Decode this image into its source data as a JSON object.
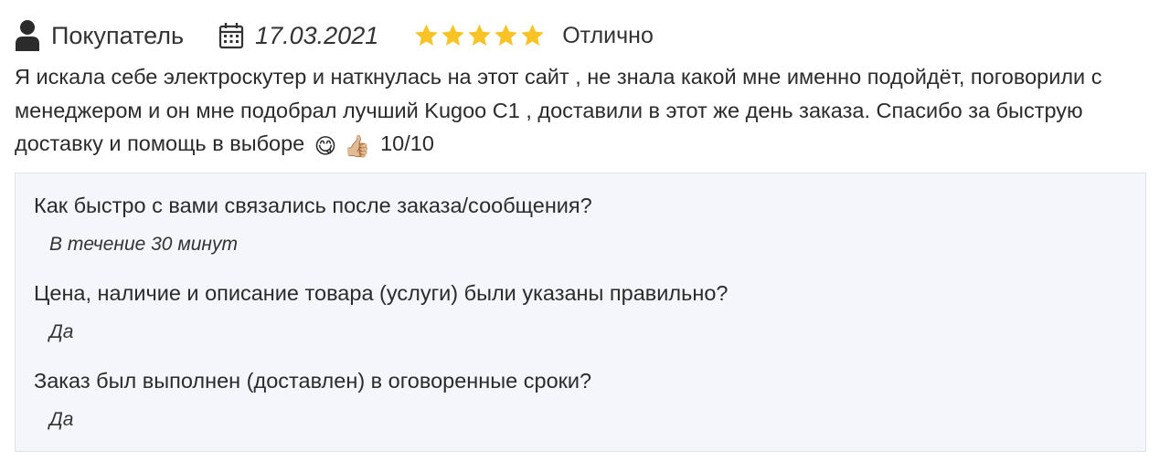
{
  "review": {
    "author": "Покупатель",
    "date": "17.03.2021",
    "rating": 5,
    "rating_max": 5,
    "rating_label": "Отлично",
    "star_color": "#f7c325",
    "text_part1": "Я искала себе электроскутер и наткнулась на этот сайт , не знала какой мне именно подойдёт, поговорили с менеджером и он мне подобрал лучший Kugoo C1 , доставили в этот же день заказа. Спасибо за быструю доставку и помощь в выборе",
    "emoji_smile": "😋",
    "emoji_thumb": "👍🏼",
    "score": "10/10",
    "icons": {
      "user": "user-icon",
      "date": "calendar-icon",
      "star": "star-icon"
    }
  },
  "qa": [
    {
      "question": "Как быстро с вами связались после заказа/сообщения?",
      "answer": "В течение 30 минут"
    },
    {
      "question": "Цена, наличие и описание товара (услуги) были указаны правильно?",
      "answer": "Да"
    },
    {
      "question": "Заказ был выполнен (доставлен) в оговоренные сроки?",
      "answer": "Да"
    }
  ]
}
